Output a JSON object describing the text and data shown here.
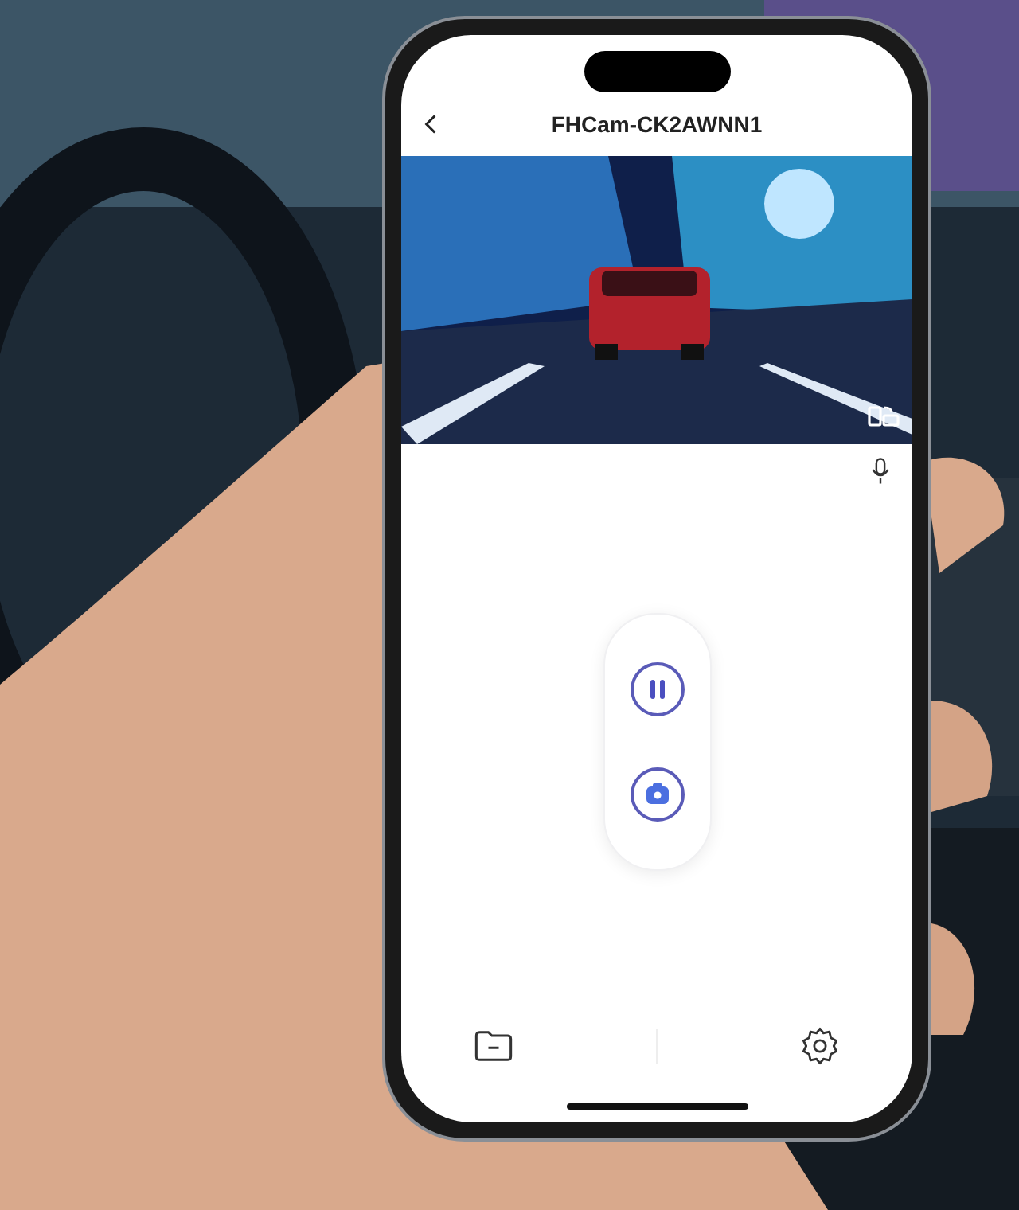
{
  "header": {
    "title": "FHCam-CK2AWNN1"
  }
}
